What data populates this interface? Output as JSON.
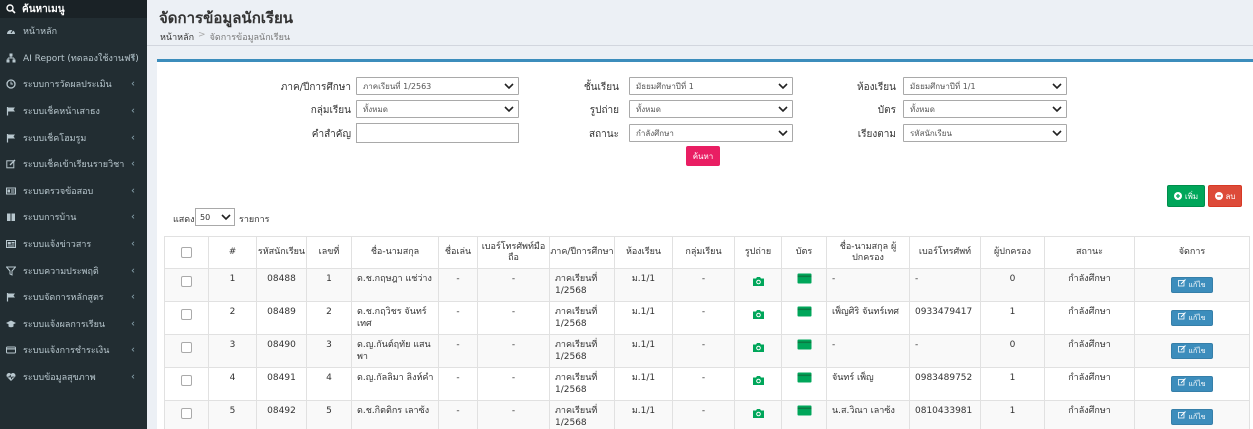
{
  "sidebar": {
    "search_label": "ค้นหาเมนู",
    "items": [
      {
        "label": "หน้าหลัก",
        "icon": "dashboard-icon",
        "has_chevron": false
      },
      {
        "label": "AI Report (ทดลองใช้งานฟรี)",
        "icon": "sitemap-icon",
        "has_chevron": true
      },
      {
        "label": "ระบบการวัดผลประเมิน",
        "icon": "clock-icon",
        "has_chevron": true
      },
      {
        "label": "ระบบเช็คหน้าเสาธง",
        "icon": "flag-icon",
        "has_chevron": true
      },
      {
        "label": "ระบบเช็คโฮมรูม",
        "icon": "flag-icon",
        "has_chevron": true
      },
      {
        "label": "ระบบเช็คเข้าเรียนรายวิชา",
        "icon": "edit-icon",
        "has_chevron": true
      },
      {
        "label": "ระบบตรวจข้อสอบ",
        "icon": "id-card-icon",
        "has_chevron": true
      },
      {
        "label": "ระบบการบ้าน",
        "icon": "book-icon",
        "has_chevron": true
      },
      {
        "label": "ระบบแจ้งข่าวสาร",
        "icon": "newspaper-icon",
        "has_chevron": true
      },
      {
        "label": "ระบบความประพฤติ",
        "icon": "filter-icon",
        "has_chevron": true
      },
      {
        "label": "ระบบจัดการหลักสูตร",
        "icon": "flag-icon",
        "has_chevron": true
      },
      {
        "label": "ระบบแจ้งผลการเรียน",
        "icon": "graduation-cap-icon",
        "has_chevron": true
      },
      {
        "label": "ระบบแจ้งการชำระเงิน",
        "icon": "credit-card-icon",
        "has_chevron": true
      },
      {
        "label": "ระบบข้อมูลสุขภาพ",
        "icon": "heartbeat-icon",
        "has_chevron": true
      }
    ]
  },
  "header": {
    "title": "จัดการข้อมูลนักเรียน",
    "breadcrumb": [
      "หน้าหลัก",
      "จัดการข้อมูลนักเรียน"
    ]
  },
  "filters": {
    "term_label": "ภาค/ปีการศึกษา",
    "term_value": "ภาคเรียนที่ 1/2563",
    "grade_label": "ชั้นเรียน",
    "grade_value": "มัธยมศึกษาปีที่ 1",
    "room_label": "ห้องเรียน",
    "room_value": "มัธยมศึกษาปีที่ 1/1",
    "group_label": "กลุ่มเรียน",
    "group_value": "ทั้งหมด",
    "photo_label": "รูปถ่าย",
    "photo_value": "ทั้งหมด",
    "card_label": "บัตร",
    "card_value": "ทั้งหมด",
    "keyword_label": "คำสำคัญ",
    "keyword_value": "",
    "status_label": "สถานะ",
    "status_value": "กำลังศึกษา",
    "sort_label": "เรียงตาม",
    "sort_value": "รหัสนักเรียน",
    "search_button": "ค้นหา"
  },
  "actions": {
    "add_label": "เพิ่ม",
    "delete_label": "ลบ"
  },
  "length": {
    "prefix": "แสดง",
    "value": "50",
    "suffix": "รายการ"
  },
  "table": {
    "headers": [
      "",
      "#",
      "รหัสนักเรียน",
      "เลขที่",
      "ชื่อ-นามสกุล",
      "ชื่อเล่น",
      "เบอร์โทรศัพท์มือถือ",
      "ภาค/ปีการศึกษา",
      "ห้องเรียน",
      "กลุ่มเรียน",
      "รูปถ่าย",
      "บัตร",
      "ชื่อ-นามสกุล ผู้ปกครอง",
      "เบอร์โทรศัพท์",
      "ผู้ปกครอง",
      "สถานะ",
      "จัดการ"
    ],
    "edit_label": "แก้ไข",
    "rows": [
      {
        "n": "1",
        "id": "08488",
        "no": "1",
        "name": "ด.ช.กฤษฎา แช่ว่าง",
        "nick": "-",
        "mobile": "-",
        "term": "ภาคเรียนที่ 1/2568",
        "room": "ม.1/1",
        "group": "-",
        "parent": "-",
        "phone": "-",
        "pcount": "0",
        "status": "กำลังศึกษา"
      },
      {
        "n": "2",
        "id": "08489",
        "no": "2",
        "name": "ด.ช.กฤวิชร จันทร์เทศ",
        "nick": "-",
        "mobile": "-",
        "term": "ภาคเรียนที่ 1/2568",
        "room": "ม.1/1",
        "group": "-",
        "parent": "เพ็ญศิริ จันทร์เทศ",
        "phone": "0933479417",
        "pcount": "1",
        "status": "กำลังศึกษา"
      },
      {
        "n": "3",
        "id": "08490",
        "no": "3",
        "name": "ด.ญ.กันต์ฤทัย แสนพา",
        "nick": "-",
        "mobile": "-",
        "term": "ภาคเรียนที่ 1/2568",
        "room": "ม.1/1",
        "group": "-",
        "parent": "-",
        "phone": "-",
        "pcount": "0",
        "status": "กำลังศึกษา"
      },
      {
        "n": "4",
        "id": "08491",
        "no": "4",
        "name": "ด.ญ.กัลลิมา ลิงห์คำ",
        "nick": "-",
        "mobile": "-",
        "term": "ภาคเรียนที่ 1/2568",
        "room": "ม.1/1",
        "group": "-",
        "parent": "จันทร์ เพ็ญ",
        "phone": "0983489752",
        "pcount": "1",
        "status": "กำลังศึกษา"
      },
      {
        "n": "5",
        "id": "08492",
        "no": "5",
        "name": "ด.ช.กิตติกร เลาซ้ง",
        "nick": "-",
        "mobile": "-",
        "term": "ภาคเรียนที่ 1/2568",
        "room": "ม.1/1",
        "group": "-",
        "parent": "น.ส.วิณา เลาซ้ง",
        "phone": "0810433981",
        "pcount": "1",
        "status": "กำลังศึกษา"
      }
    ]
  },
  "colors": {
    "sidebar_bg": "#222d32",
    "primary": "#3c8dbc",
    "success": "#00a65a",
    "danger": "#dd4b39",
    "pink": "#e91e63",
    "camera": "#00a65a"
  }
}
